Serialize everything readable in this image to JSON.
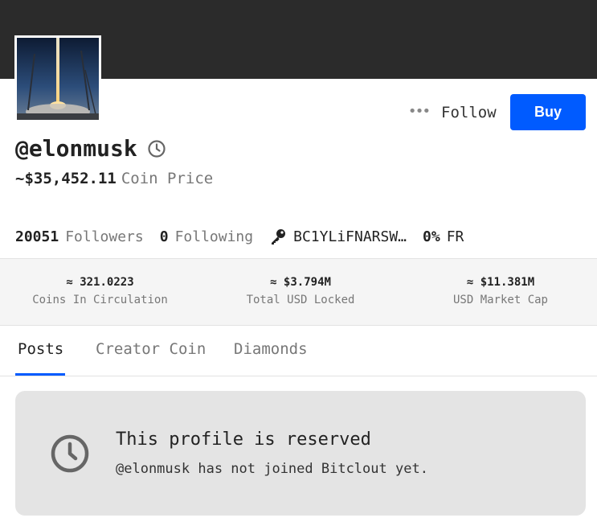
{
  "profile": {
    "username": "@elonmusk",
    "coin_price": "~$35,452.11",
    "coin_price_label": "Coin Price",
    "avatar_description": "rocket-launch-photo"
  },
  "actions": {
    "more_label": "•••",
    "follow_label": "Follow",
    "buy_label": "Buy"
  },
  "stats": {
    "followers_count": "20051",
    "followers_label": "Followers",
    "following_count": "0",
    "following_label": "Following",
    "public_key": "BC1YLiFNARSW…",
    "founder_reward": "0%",
    "founder_reward_label": "FR"
  },
  "metrics": [
    {
      "value": "≈ 321.0223",
      "label": "Coins In Circulation"
    },
    {
      "value": "≈ $3.794M",
      "label": "Total USD Locked"
    },
    {
      "value": "≈ $11.381M",
      "label": "USD Market Cap"
    }
  ],
  "tabs": [
    {
      "label": "Posts",
      "active": true
    },
    {
      "label": "Creator Coin",
      "active": false
    },
    {
      "label": "Diamonds",
      "active": false
    }
  ],
  "reserved": {
    "title": "This profile is reserved",
    "message": "@elonmusk has not joined Bitclout yet."
  },
  "colors": {
    "accent": "#005bff",
    "banner": "#2b2b2b",
    "card": "#e4e4e4"
  },
  "icons": {
    "clock": "clock-icon",
    "key": "key-icon",
    "more": "more-dots-icon"
  }
}
